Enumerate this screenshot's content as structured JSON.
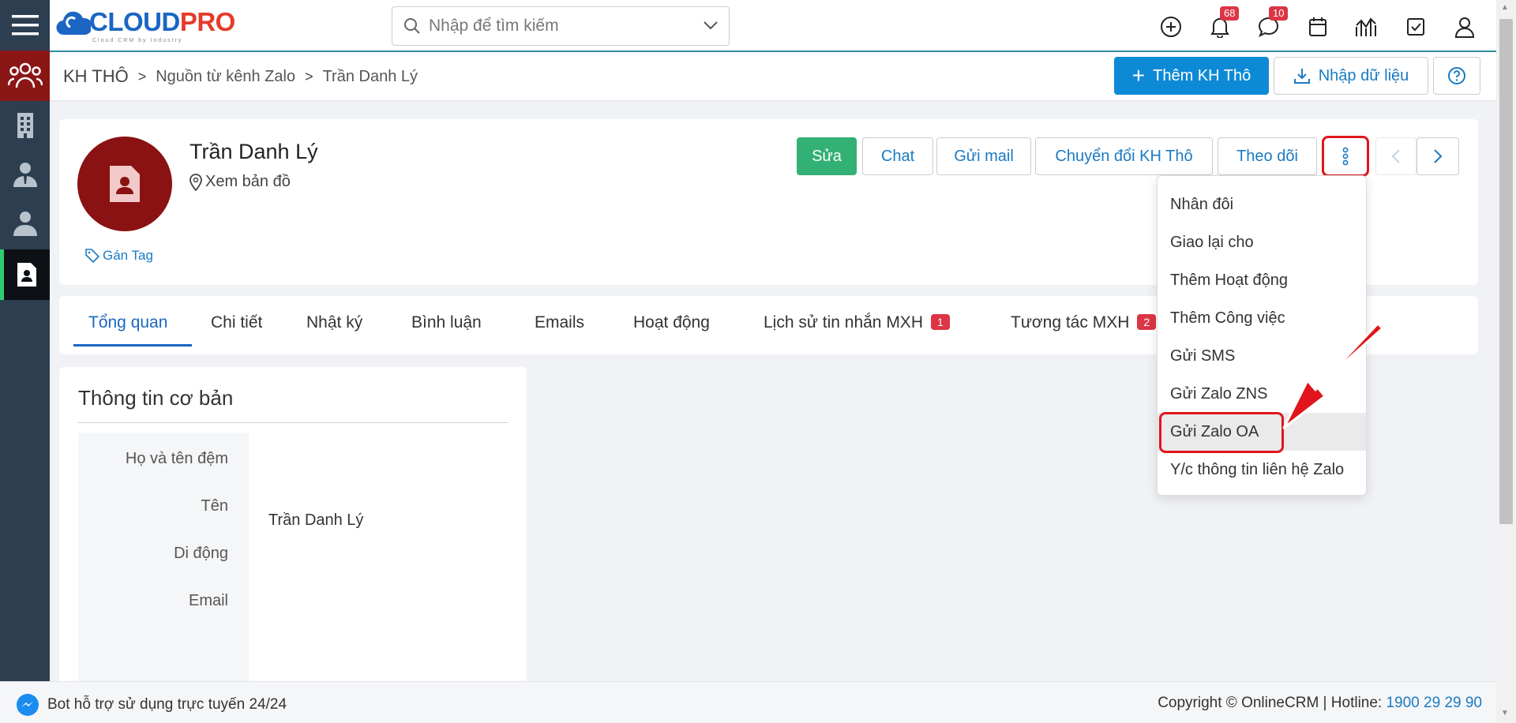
{
  "header": {
    "logo_main": "CLOUD",
    "logo_accent": "PRO",
    "logo_sub": "Cloud CRM by Industry",
    "search_placeholder": "Nhập để tìm kiếm",
    "notifications_count": "68",
    "messages_count": "10"
  },
  "breadcrumb": {
    "module": "KH THÔ",
    "source": "Nguồn từ kênh Zalo",
    "record": "Trần Danh Lý"
  },
  "toolbar": {
    "add_lead": "Thêm KH Thô",
    "import": "Nhập dữ liệu"
  },
  "profile": {
    "name": "Trần Danh Lý",
    "map_link": "Xem bản đồ",
    "tag_link": "Gán Tag"
  },
  "actions": {
    "edit": "Sửa",
    "chat": "Chat",
    "send_mail": "Gửi mail",
    "convert": "Chuyển đổi KH Thô",
    "follow": "Theo dõi"
  },
  "tabs": [
    {
      "label": "Tổng quan"
    },
    {
      "label": "Chi tiết"
    },
    {
      "label": "Nhật ký"
    },
    {
      "label": "Bình luận"
    },
    {
      "label": "Emails"
    },
    {
      "label": "Hoạt động"
    },
    {
      "label": "Lịch sử tin nhắn MXH",
      "badge": "1"
    },
    {
      "label": "Tương tác MXH",
      "badge": "2"
    }
  ],
  "info": {
    "title": "Thông tin cơ bản",
    "fields": [
      {
        "label": "Họ và tên đệm",
        "value": ""
      },
      {
        "label": "Tên",
        "value": "Trần Danh Lý"
      },
      {
        "label": "Di động",
        "value": ""
      },
      {
        "label": "Email",
        "value": ""
      }
    ]
  },
  "dropdown": {
    "items": [
      "Nhân đôi",
      "Giao lại cho",
      "Thêm Hoạt động",
      "Thêm Công việc",
      "Gửi SMS",
      "Gửi Zalo ZNS",
      "Gửi Zalo OA",
      "Y/c thông tin liên hệ Zalo"
    ]
  },
  "footer": {
    "bot_text": "Bot hỗ trợ sử dụng trực tuyến 24/24",
    "copyright": "Copyright © OnlineCRM",
    "hotline_label": "Hotline: ",
    "hotline_number": "1900 29 29 90"
  },
  "colors": {
    "primary": "#0d8ad6",
    "edit_green": "#33b074",
    "sidebar": "#2c3e50",
    "sidebar_active": "#8b1616",
    "highlight_red": "#e0161c"
  }
}
